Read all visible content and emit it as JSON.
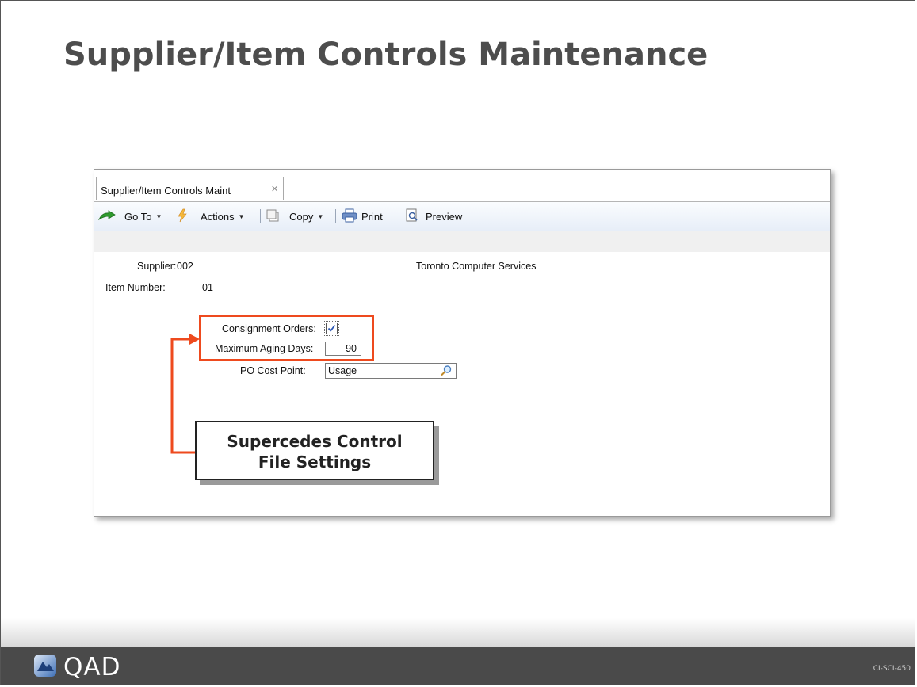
{
  "slide": {
    "title": "Supplier/Item Controls Maintenance",
    "footer_logo_text": "QAD",
    "slide_code": "CI-SCI-450"
  },
  "tab": {
    "label": "Supplier/Item Controls Maint",
    "close_glyph": "×"
  },
  "toolbar": {
    "goto_label": "Go To",
    "actions_label": "Actions",
    "copy_label": "Copy",
    "print_label": "Print",
    "preview_label": "Preview",
    "dropdown_glyph": "▼"
  },
  "form": {
    "supplier_label": "Supplier:",
    "supplier_value": "002",
    "supplier_name": "Toronto Computer Services",
    "item_number_label": "Item Number:",
    "item_number_value": "01",
    "consignment_label": "Consignment Orders:",
    "consignment_checked": true,
    "max_aging_label": "Maximum Aging Days:",
    "max_aging_value": "90",
    "po_cost_point_label": "PO Cost Point:",
    "po_cost_point_value": "Usage"
  },
  "callout": {
    "line1": "Supercedes Control",
    "line2": "File Settings"
  },
  "icons": [
    "goto-arrow-icon",
    "actions-lightning-icon",
    "copy-icon",
    "print-icon",
    "preview-icon",
    "lookup-magnifier-icon",
    "checkmark-icon",
    "qad-logo-icon"
  ],
  "colors": {
    "highlight": "#ee4a1e",
    "footer": "#4a4a4a",
    "toolbar_bg": "#e7eef8"
  }
}
